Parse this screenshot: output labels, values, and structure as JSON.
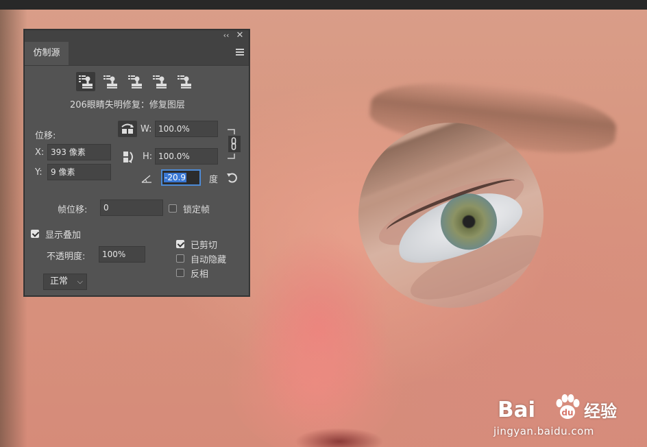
{
  "panel": {
    "tab_label": "仿制源",
    "source_name": "206眼睛失明修复：修复图层",
    "offset_label": "位移:",
    "x_label": "X:",
    "x_value": "393 像素",
    "y_label": "Y:",
    "y_value": "9 像素",
    "w_label": "W:",
    "w_value": "100.0%",
    "h_label": "H:",
    "h_value": "100.0%",
    "angle_value": "-20.9",
    "angle_unit": "度",
    "frame_offset_label": "帧位移:",
    "frame_offset_value": "0",
    "lock_frame_label": "锁定帧",
    "show_overlay_label": "显示叠加",
    "opacity_label": "不透明度:",
    "opacity_value": "100%",
    "clipped_label": "已剪切",
    "auto_hide_label": "自动隐藏",
    "invert_label": "反相",
    "blend_mode": "正常",
    "checks": {
      "lock_frame": false,
      "show_overlay": true,
      "clipped": true,
      "auto_hide": false,
      "invert": false
    }
  },
  "watermark": {
    "brand_left": "Bai",
    "brand_right": "经验",
    "url": "jingyan.baidu.com"
  },
  "icons": [
    "collapse-icon",
    "close-icon",
    "panel-menu-icon",
    "clone-source-icon",
    "flip-horizontal-icon",
    "flip-vertical-icon",
    "link-icon",
    "angle-icon",
    "reset-icon",
    "chevron-down-icon",
    "paw-icon"
  ],
  "colors": {
    "panel_bg": "#535353",
    "panel_header": "#424242",
    "focus_border": "#4d8bd7",
    "selection": "#3a78d4"
  }
}
